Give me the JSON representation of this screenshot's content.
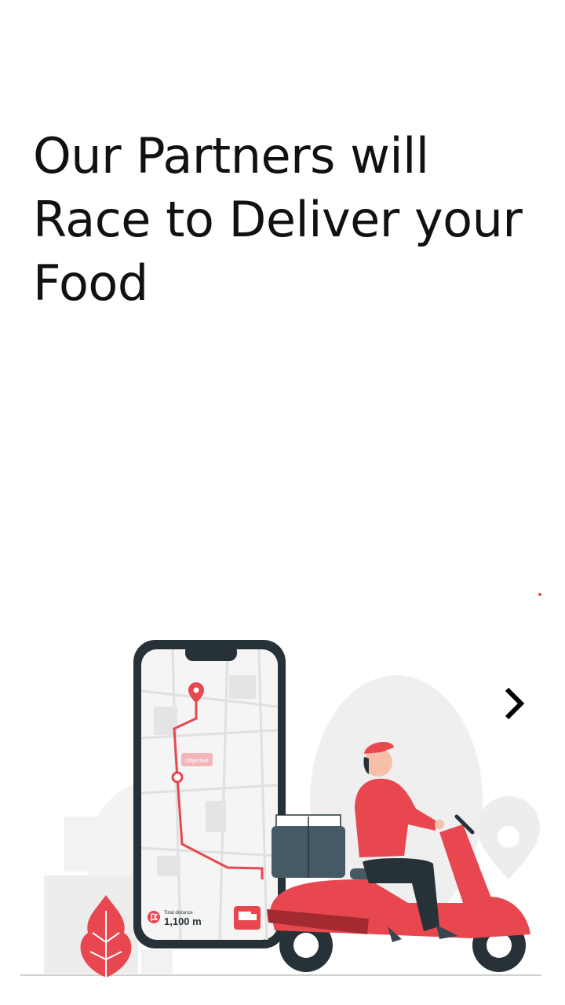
{
  "onboarding": {
    "headline": "Our Partners will Race to Deliver your Food",
    "next_icon": "chevron-right-icon"
  },
  "phone_screen": {
    "tag_label": "Objective",
    "distance_caption": "Total distance",
    "distance_value": "1,100 m"
  },
  "colors": {
    "accent": "#E8474F",
    "dark": "#263238",
    "light_gray": "#EBEBEB"
  }
}
